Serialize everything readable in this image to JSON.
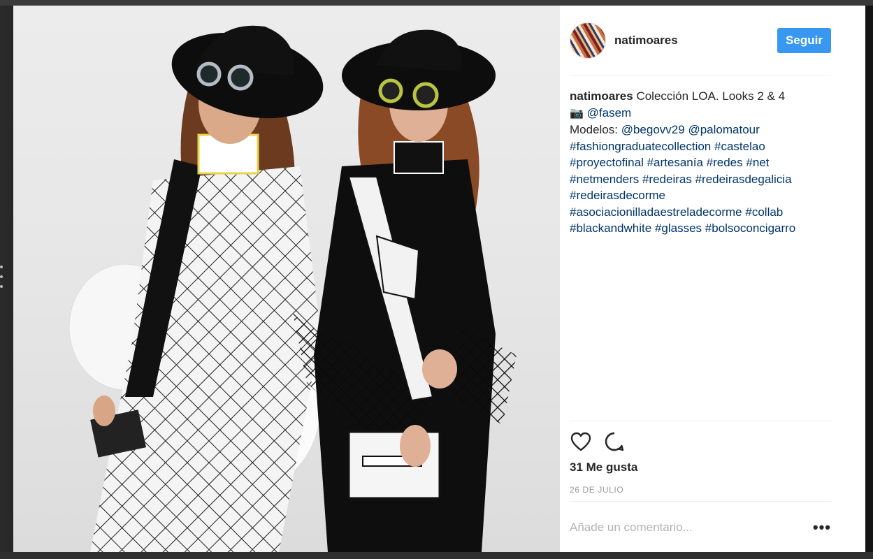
{
  "post": {
    "username": "natimoares",
    "follow_label": "Seguir",
    "caption": {
      "username": "natimoares",
      "line1": "Colección LOA. Looks 2 & 4",
      "camera": "📷",
      "mention_fasem": "@fasem",
      "modelos_label": "Modelos:",
      "mention_begovv29": "@begovv29",
      "mention_palomatour": "@palomatour",
      "tags": [
        "#fashiongraduatecollection",
        "#castelao",
        "#proyectofinal",
        "#artesanía",
        "#redes",
        "#net",
        "#netmenders",
        "#redeiras",
        "#redeirasdegalicia",
        "#redeirasdecorme",
        "#asociacionilladaestreladecorme",
        "#collab",
        "#blackandwhite",
        "#glasses",
        "#bolsoconcigarro"
      ]
    },
    "likes_label": "31 Me gusta",
    "date_label": "26 DE JULIO",
    "comment_placeholder": "Añade un comentario...",
    "more_label": "•••"
  },
  "colors": {
    "accent": "#3897f0",
    "link": "#003569",
    "text": "#262626",
    "muted": "#999999"
  },
  "icons": [
    "heart-icon",
    "comment-icon",
    "more-options-icon"
  ]
}
